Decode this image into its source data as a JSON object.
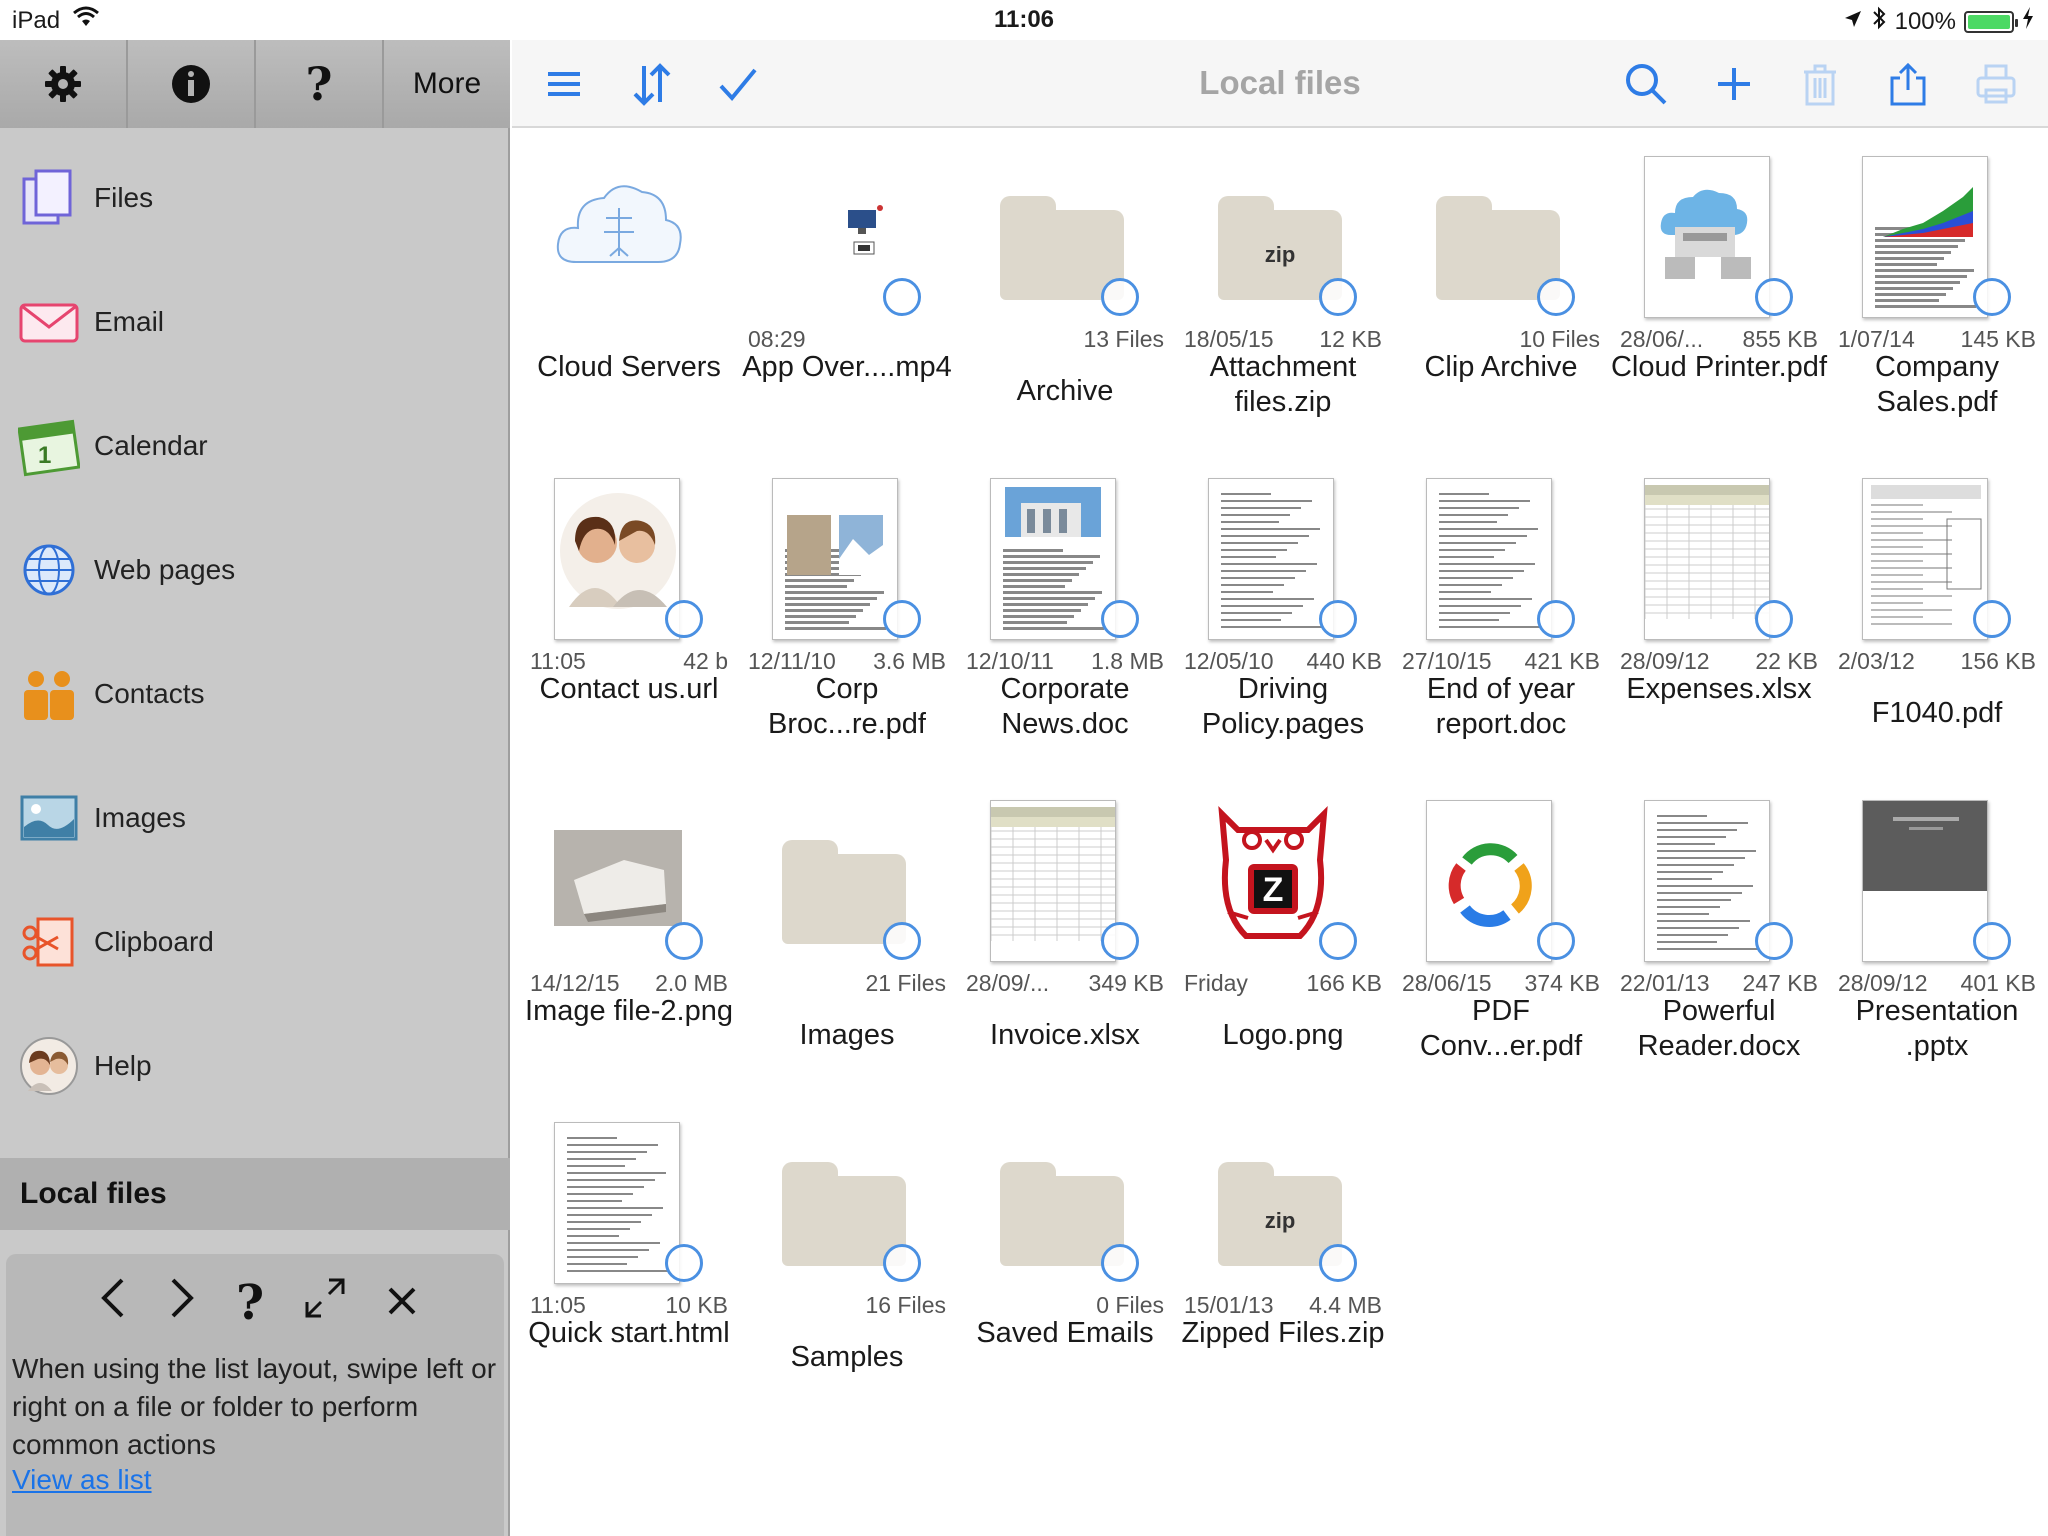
{
  "status_bar": {
    "device": "iPad",
    "time": "11:06",
    "battery": "100%"
  },
  "sidebar": {
    "toolbar": {
      "more_label": "More"
    },
    "items": [
      {
        "label": "Files",
        "icon": "files-icon"
      },
      {
        "label": "Email",
        "icon": "email-icon"
      },
      {
        "label": "Calendar",
        "icon": "calendar-icon"
      },
      {
        "label": "Web pages",
        "icon": "globe-icon"
      },
      {
        "label": "Contacts",
        "icon": "contacts-icon"
      },
      {
        "label": "Images",
        "icon": "images-icon"
      },
      {
        "label": "Clipboard",
        "icon": "clipboard-icon"
      },
      {
        "label": "Help",
        "icon": "help-avatar-icon"
      }
    ],
    "section_title": "Local files",
    "tip": {
      "text": "When using the list layout, swipe left or right on a file or folder to perform common actions",
      "link": "View as list"
    }
  },
  "header": {
    "title": "Local files"
  },
  "files": [
    {
      "name": "Cloud Servers",
      "date": "",
      "size": "",
      "kind": "cloud"
    },
    {
      "name": "App Over....mp4",
      "date": "08:29",
      "size": "",
      "kind": "video"
    },
    {
      "name": "Archive",
      "date": "",
      "size": "13 Files",
      "kind": "folder"
    },
    {
      "name": "Attachment files.zip",
      "date": "18/05/15",
      "size": "12 KB",
      "kind": "zip"
    },
    {
      "name": "Clip Archive",
      "date": "",
      "size": "10 Files",
      "kind": "folder"
    },
    {
      "name": "Cloud Printer.pdf",
      "date": "28/06/...",
      "size": "855 KB",
      "kind": "doc-cloud"
    },
    {
      "name": "Company Sales.pdf",
      "date": "1/07/14",
      "size": "145 KB",
      "kind": "doc-chart"
    },
    {
      "name": "Contact us.url",
      "date": "11:05",
      "size": "42 b",
      "kind": "doc-people"
    },
    {
      "name": "Corp Broc...re.pdf",
      "date": "12/11/10",
      "size": "3.6 MB",
      "kind": "doc-brochure"
    },
    {
      "name": "Corporate News.doc",
      "date": "12/10/11",
      "size": "1.8 MB",
      "kind": "doc-news"
    },
    {
      "name": "Driving Policy.pages",
      "date": "12/05/10",
      "size": "440 KB",
      "kind": "doc-text"
    },
    {
      "name": "End of year report.doc",
      "date": "27/10/15",
      "size": "421 KB",
      "kind": "doc-text"
    },
    {
      "name": "Expenses.xlsx",
      "date": "28/09/12",
      "size": "22 KB",
      "kind": "doc-sheet"
    },
    {
      "name": "F1040.pdf",
      "date": "2/03/12",
      "size": "156 KB",
      "kind": "doc-form"
    },
    {
      "name": "Image file-2.png",
      "date": "14/12/15",
      "size": "2.0 MB",
      "kind": "photo"
    },
    {
      "name": "Images",
      "date": "",
      "size": "21 Files",
      "kind": "folder"
    },
    {
      "name": "Invoice.xlsx",
      "date": "28/09/...",
      "size": "349 KB",
      "kind": "doc-sheet"
    },
    {
      "name": "Logo.png",
      "date": "Friday",
      "size": "166 KB",
      "kind": "logo"
    },
    {
      "name": "PDF Conv...er.pdf",
      "date": "28/06/15",
      "size": "374 KB",
      "kind": "doc-cycle"
    },
    {
      "name": "Powerful Reader.docx",
      "date": "22/01/13",
      "size": "247 KB",
      "kind": "doc-text"
    },
    {
      "name": "Presentation .pptx",
      "date": "28/09/12",
      "size": "401 KB",
      "kind": "doc-slide"
    },
    {
      "name": "Quick start.html",
      "date": "11:05",
      "size": "10 KB",
      "kind": "doc-text"
    },
    {
      "name": "Samples",
      "date": "",
      "size": "16 Files",
      "kind": "folder"
    },
    {
      "name": "Saved Emails",
      "date": "",
      "size": "0 Files",
      "kind": "folder"
    },
    {
      "name": "Zipped Files.zip",
      "date": "15/01/13",
      "size": "4.4 MB",
      "kind": "zip"
    }
  ],
  "zip_label": "zip",
  "colors": {
    "accent": "#2e7ce6",
    "sidebar_bg": "#c9c9c9",
    "folder": "#ddd8cc",
    "header_title": "#a5a5a5"
  }
}
